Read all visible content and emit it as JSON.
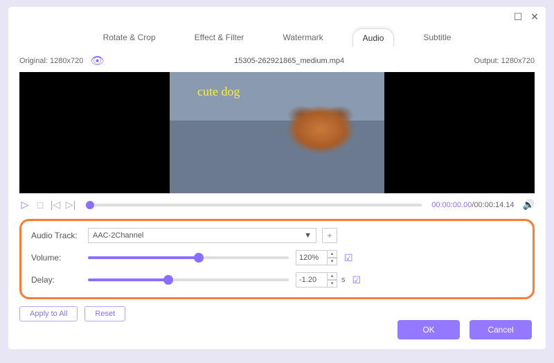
{
  "titlebar": {
    "maximize": "☐",
    "close": "✕"
  },
  "tabs": [
    {
      "label": "Rotate & Crop",
      "active": false
    },
    {
      "label": "Effect & Filter",
      "active": false
    },
    {
      "label": "Watermark",
      "active": false
    },
    {
      "label": "Audio",
      "active": true
    },
    {
      "label": "Subtitle",
      "active": false
    }
  ],
  "info": {
    "original_label": "Original:",
    "original_value": "1280x720",
    "filename": "15305-262921865_medium.mp4",
    "output_label": "Output:",
    "output_value": "1280x720"
  },
  "preview": {
    "overlay_text": "cute dog"
  },
  "playback": {
    "current": "00:00:00.00",
    "duration": "00:00:14.14"
  },
  "audio": {
    "track_label": "Audio Track:",
    "track_value": "AAC-2Channel",
    "volume_label": "Volume:",
    "volume_value": "120%",
    "volume_percent": 55,
    "delay_label": "Delay:",
    "delay_value": "-1.20",
    "delay_unit": "s",
    "delay_percent": 40
  },
  "actions": {
    "apply_all": "Apply to All",
    "reset": "Reset",
    "ok": "OK",
    "cancel": "Cancel"
  }
}
